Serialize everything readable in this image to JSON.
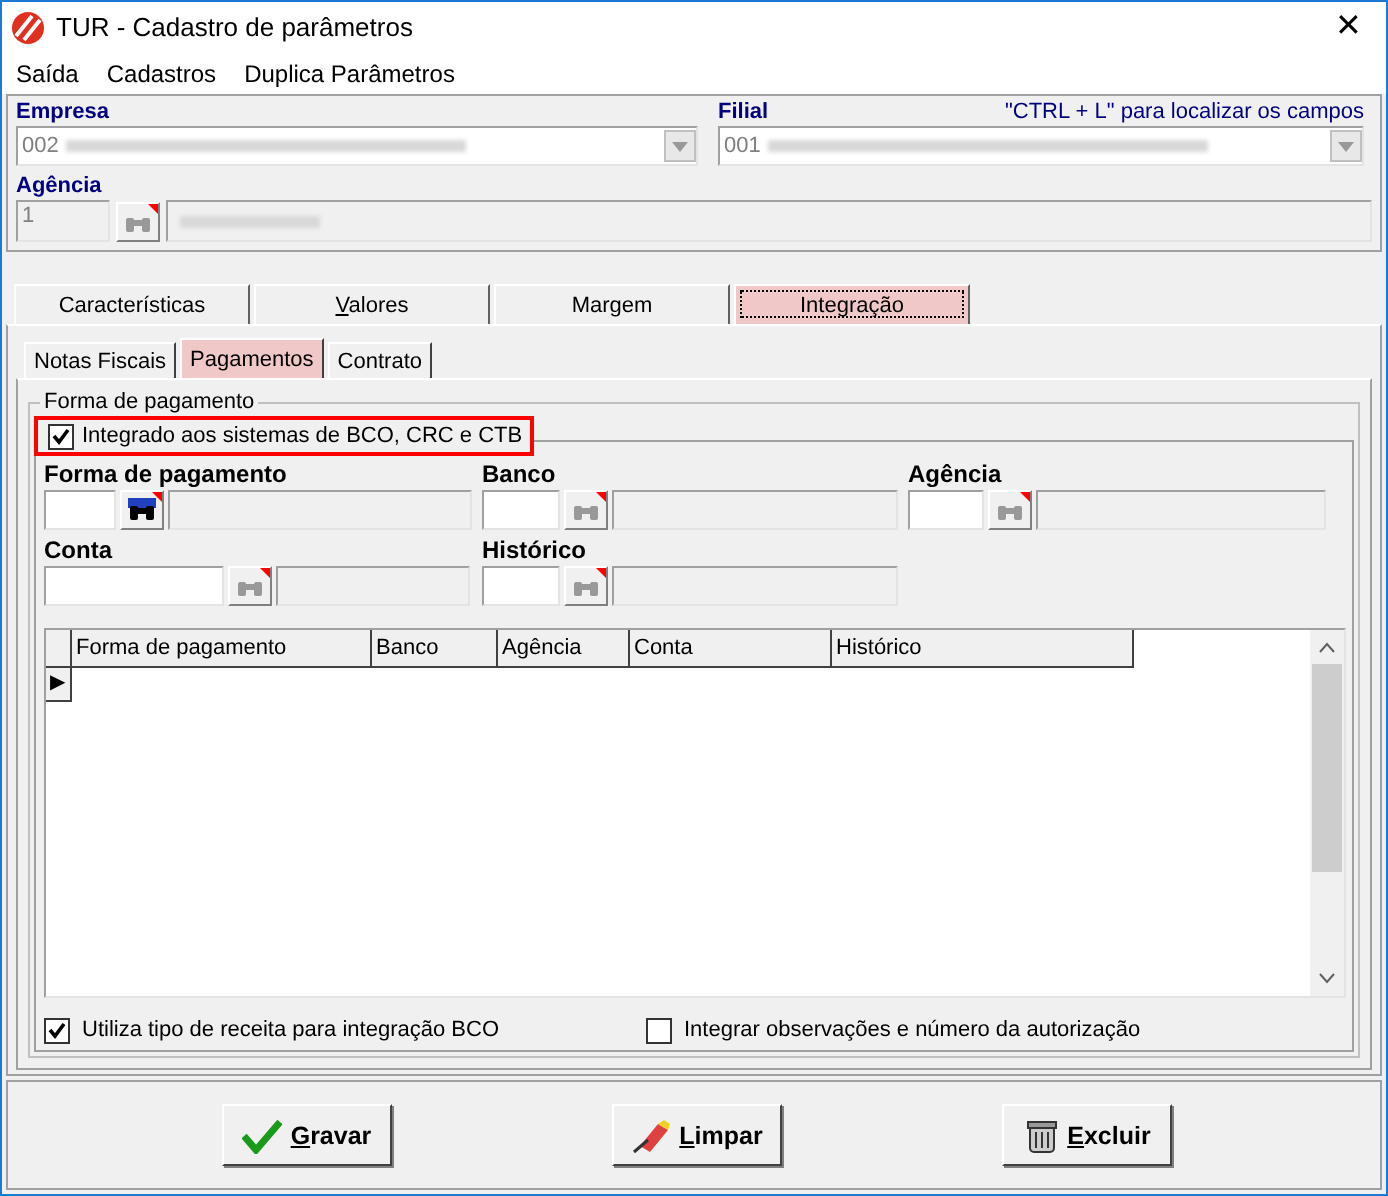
{
  "window": {
    "title": "TUR - Cadastro de parâmetros",
    "close": "✕"
  },
  "menu": [
    "Saída",
    "Cadastros",
    "Duplica Parâmetros"
  ],
  "header": {
    "empresa": {
      "label": "Empresa",
      "value": "002"
    },
    "filial": {
      "label": "Filial",
      "value": "001"
    },
    "hint": "\"CTRL + L\" para localizar os campos",
    "agencia": {
      "label": "Agência",
      "value": "1"
    }
  },
  "tabs": [
    {
      "label": "Características",
      "selected": false
    },
    {
      "label": "Valores",
      "selected": false
    },
    {
      "label": "Margem",
      "selected": false
    },
    {
      "label": "Integração",
      "selected": true
    }
  ],
  "subtabs": [
    {
      "label": "Notas Fiscais",
      "selected": false
    },
    {
      "label": "Pagamentos",
      "selected": true
    },
    {
      "label": "Contrato",
      "selected": false
    }
  ],
  "group": {
    "title": "Forma de pagamento",
    "integrated": {
      "label": "Integrado aos sistemas de BCO, CRC e CTB",
      "checked": true
    },
    "rows": [
      [
        {
          "label": "Forma de pagamento",
          "enabled": true
        },
        {
          "label": "Banco",
          "enabled": false
        },
        {
          "label": "Agência",
          "enabled": false
        }
      ],
      [
        {
          "label": "Conta",
          "enabled": false
        },
        {
          "label": "Histórico",
          "enabled": false
        }
      ]
    ],
    "grid": {
      "columns": [
        "Forma de pagamento",
        "Banco",
        "Agência",
        "Conta",
        "Histórico"
      ],
      "current_row": "▶"
    },
    "options": [
      {
        "label": "Utiliza tipo de receita para integração BCO",
        "checked": true
      },
      {
        "label": "Integrar observações e número da autorização",
        "checked": false
      }
    ]
  },
  "buttons": [
    {
      "label": "Gravar",
      "kind": "save"
    },
    {
      "label": "Limpar",
      "kind": "clear"
    },
    {
      "label": "Excluir",
      "kind": "delete"
    }
  ]
}
